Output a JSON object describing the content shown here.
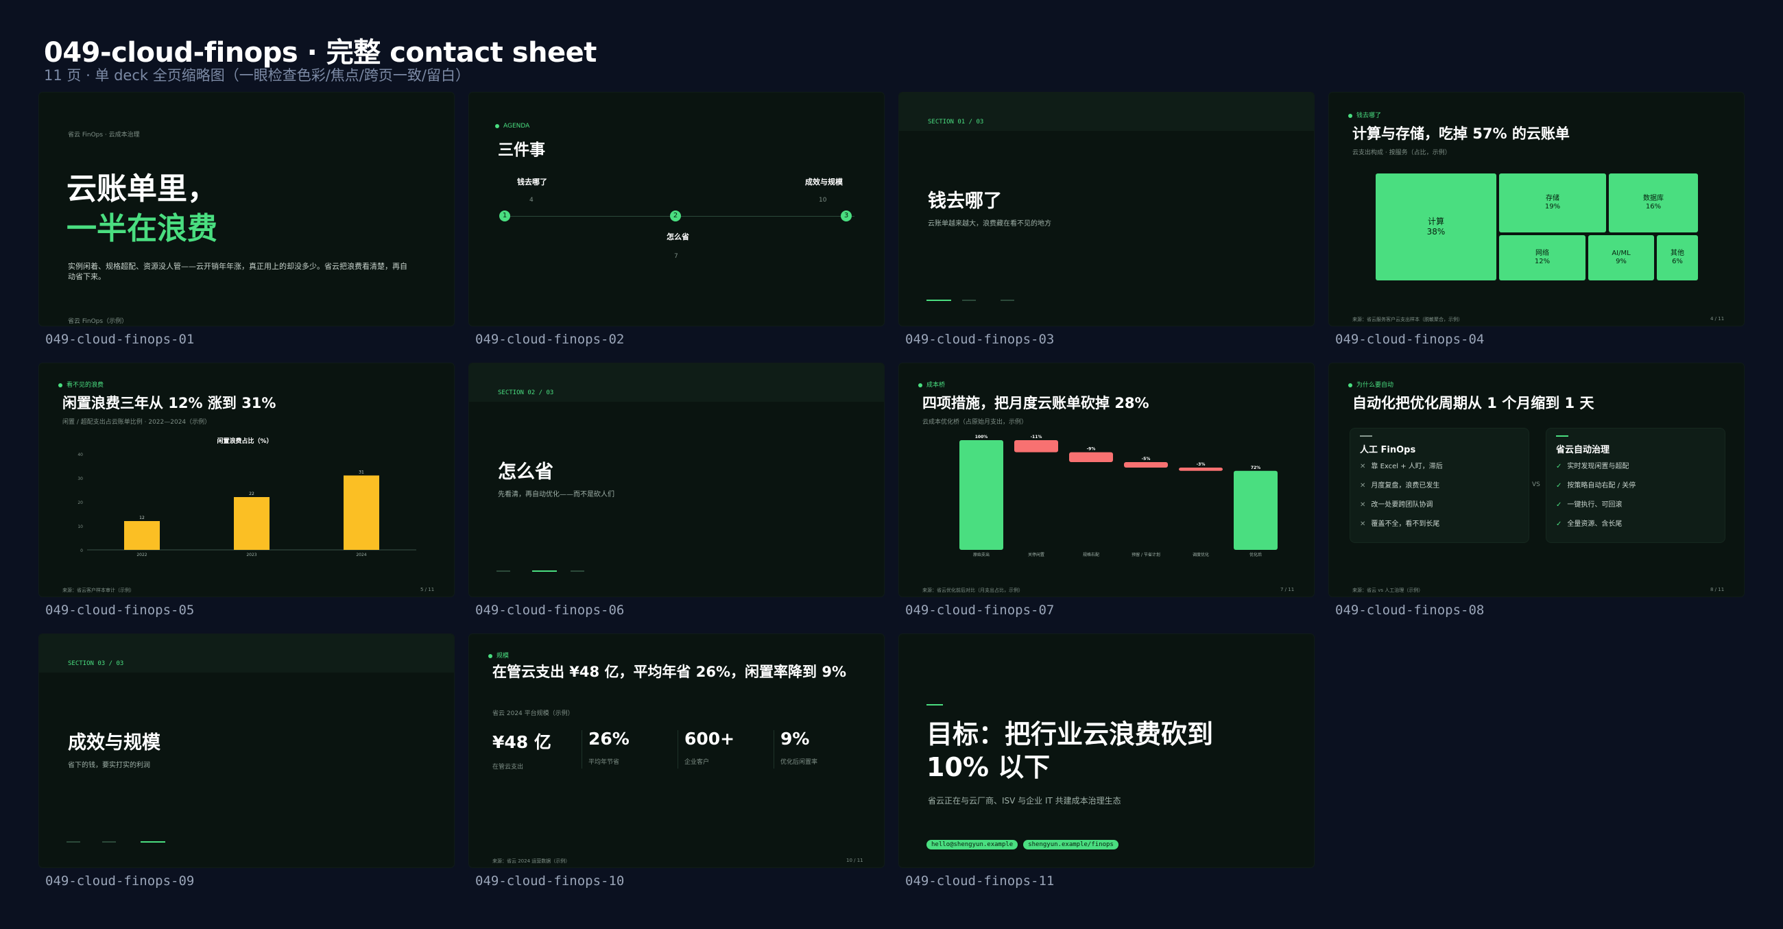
{
  "sheet": {
    "title": "049-cloud-finops · 完整 contact sheet",
    "subtitle": "11 页 · 单 deck 全页缩略图（一眼检查色彩/焦点/跨页一致/留白）"
  },
  "colors": {
    "background": "#0b1120",
    "slide_bg": "#0a1410",
    "accent": "#4ade80",
    "chart_yellow": "#fbbf24",
    "negative": "#f87171"
  },
  "slides": {
    "s01": {
      "caption": "049-cloud-finops-01",
      "kicker": "省云 FinOps · 云成本治理",
      "title_line1": "云账单里，",
      "title_line2": "一半在浪费",
      "body": "实例闲着、规格超配、资源没人管——云开销年年涨，真正用上的却没多少。省云把浪费看清楚，再自动省下来。",
      "footer": "省云 FinOps（示例）"
    },
    "s02": {
      "caption": "049-cloud-finops-02",
      "label": "AGENDA",
      "title": "三件事",
      "items": [
        {
          "num": "1",
          "label": "钱去哪了",
          "page": "4"
        },
        {
          "num": "2",
          "label": "怎么省",
          "page": "7"
        },
        {
          "num": "3",
          "label": "成效与规模",
          "page": "10"
        }
      ]
    },
    "s03": {
      "caption": "049-cloud-finops-03",
      "section": "SECTION 01 / 03",
      "title": "钱去哪了",
      "sub": "云账单越来越大，浪费藏在看不见的地方"
    },
    "s04": {
      "caption": "049-cloud-finops-04",
      "label": "钱去哪了",
      "title": "计算与存储，吃掉 57% 的云账单",
      "sub": "云支出构成 · 按服务（占比，示例）",
      "cells": [
        {
          "name": "计算",
          "value": "38%"
        },
        {
          "name": "存储",
          "value": "19%"
        },
        {
          "name": "数据库",
          "value": "16%"
        },
        {
          "name": "网络",
          "value": "12%"
        },
        {
          "name": "AI/ML",
          "value": "9%"
        },
        {
          "name": "其他",
          "value": "6%"
        }
      ],
      "footer": "来源：省云服务客户云支出样本（脱敏聚合，示例）",
      "page": "4 / 11"
    },
    "s05": {
      "caption": "049-cloud-finops-05",
      "label": "看不见的浪费",
      "title": "闲置浪费三年从 12% 涨到 31%",
      "sub": "闲置 / 超配支出占云账单比例 · 2022—2024（示例）",
      "footer": "来源：省云客户样本审计（示例）",
      "page": "5 / 11"
    },
    "s06": {
      "caption": "049-cloud-finops-06",
      "section": "SECTION 02 / 03",
      "title": "怎么省",
      "sub": "先看清，再自动优化——而不是砍人们"
    },
    "s07": {
      "caption": "049-cloud-finops-07",
      "label": "成本桥",
      "title": "四项措施，把月度云账单砍掉 28%",
      "sub": "云成本优化桥（占原始月支出，示例）",
      "footer": "来源：省云优化前后对比（月支出占比，示例）",
      "page": "7 / 11"
    },
    "s08": {
      "caption": "049-cloud-finops-08",
      "label": "为什么要自动",
      "title": "自动化把优化周期从 1 个月缩到 1 天",
      "vs": "VS",
      "left_title": "人工 FinOps",
      "left_items": [
        "靠 Excel + 人盯，滞后",
        "月度复盘，浪费已发生",
        "改一处要跨团队协调",
        "覆盖不全，看不到长尾"
      ],
      "right_title": "省云自动治理",
      "right_items": [
        "实时发现闲置与超配",
        "按策略自动右配 / 关停",
        "一键执行、可回滚",
        "全量资源、含长尾"
      ],
      "footer": "来源：省云 vs 人工治理（示例）",
      "page": "8 / 11"
    },
    "s09": {
      "caption": "049-cloud-finops-09",
      "section": "SECTION 03 / 03",
      "title": "成效与规模",
      "sub": "省下的钱，要实打实的利润"
    },
    "s10": {
      "caption": "049-cloud-finops-10",
      "label": "规模",
      "title": "在管云支出 ¥48 亿，平均年省 26%，闲置率降到 9%",
      "sub": "省云 2024 平台规模（示例）",
      "kpis": [
        {
          "value": "¥48 亿",
          "label": "在管云支出"
        },
        {
          "value": "26%",
          "label": "平均年节省"
        },
        {
          "value": "600+",
          "label": "企业客户"
        },
        {
          "value": "9%",
          "label": "优化后闲置率"
        }
      ],
      "footer": "来源：省云 2024 运营数据（示例）",
      "page": "10 / 11"
    },
    "s11": {
      "caption": "049-cloud-finops-11",
      "title_line1": "目标：把行业云浪费砍到",
      "title_line2": "10% 以下",
      "sub": "省云正在与云厂商、ISV 与企业 IT 共建成本治理生态",
      "pill1": "hello@shengyun.example",
      "pill2": "shengyun.example/finops"
    }
  },
  "chart_data": [
    {
      "type": "bar",
      "title": "闲置浪费占比（%）",
      "categories": [
        "2022",
        "2023",
        "2024"
      ],
      "values": [
        12,
        22,
        31
      ],
      "yticks": [
        0,
        10,
        20,
        30,
        40
      ],
      "ylim": [
        0,
        40
      ],
      "color": "#fbbf24"
    },
    {
      "type": "bar",
      "subtype": "waterfall",
      "categories": [
        "原始支出",
        "关停闲置",
        "规格右配",
        "预留 / 节省计划",
        "调度优化",
        "优化后"
      ],
      "values": [
        100,
        -11,
        -9,
        -5,
        -3,
        72
      ],
      "labels": [
        "100%",
        "-11%",
        "-9%",
        "-5%",
        "-3%",
        "72%"
      ],
      "ylim": [
        0,
        100
      ]
    }
  ]
}
